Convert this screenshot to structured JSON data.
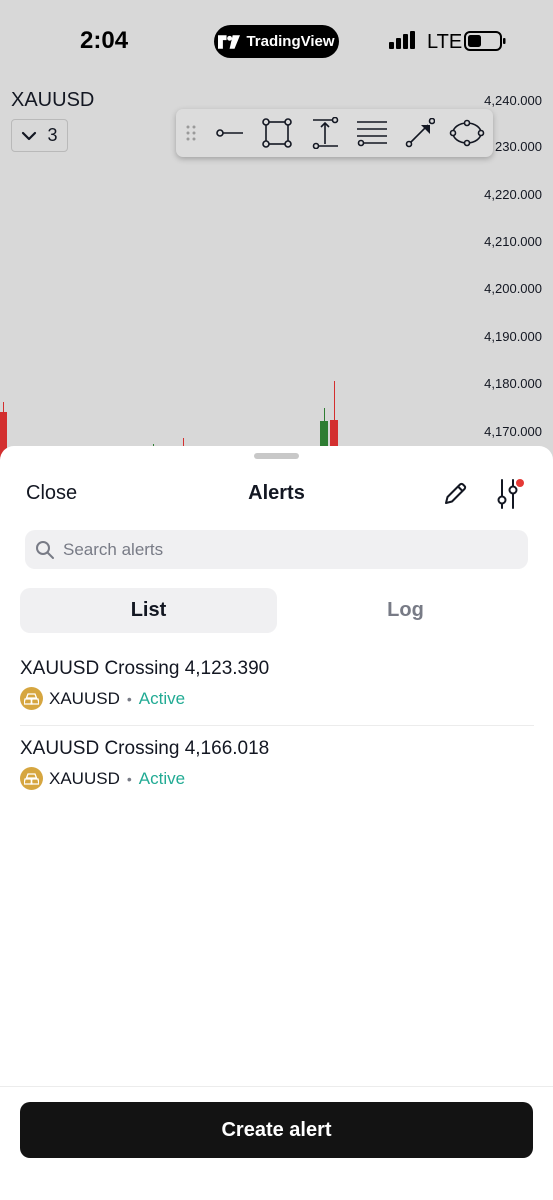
{
  "status_bar": {
    "time": "2:04",
    "island_brand": "TradingView",
    "network": "LTE"
  },
  "chart": {
    "symbol": "XAUUSD",
    "interval_value": "3",
    "price_labels": [
      "4,240.000",
      "230.000",
      "4,220.000",
      "4,210.000",
      "4,200.000",
      "4,190.000",
      "4,180.000",
      "4,170.000"
    ],
    "drawing_tools": [
      "drag-handle-icon",
      "horizontal-ray-icon",
      "rectangle-icon",
      "price-range-icon",
      "parallel-channel-icon",
      "arrow-icon",
      "ellipse-icon"
    ],
    "colors": {
      "up": "#2e7d32",
      "down": "#d32f2f"
    }
  },
  "sheet": {
    "close_label": "Close",
    "title": "Alerts",
    "search_placeholder": "Search alerts",
    "tabs": [
      {
        "label": "List",
        "active": true
      },
      {
        "label": "Log",
        "active": false
      }
    ],
    "alerts": [
      {
        "title": "XAUUSD Crossing 4,123.390",
        "symbol": "XAUUSD",
        "separator": "•",
        "status": "Active"
      },
      {
        "title": "XAUUSD Crossing 4,166.018",
        "symbol": "XAUUSD",
        "separator": "•",
        "status": "Active"
      }
    ],
    "create_label": "Create alert",
    "accent_active": "#22ab94",
    "notification_dot": "#e53935"
  }
}
